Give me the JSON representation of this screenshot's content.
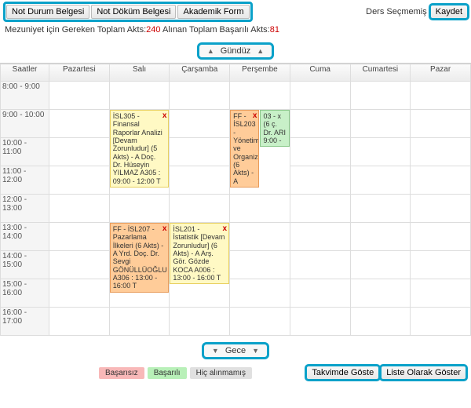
{
  "toolbar": {
    "btn1": "Not Durum Belgesi",
    "btn2": "Not Döküm Belgesi",
    "btn3": "Akademik Form",
    "right_label": "Ders Seçmemiş",
    "save": "Kaydet"
  },
  "status": {
    "prefix": "Mezuniyet için Gereken Toplam Akts:",
    "req": "240",
    "mid": " Alınan Toplam Başarılı Akts:",
    "done": "81"
  },
  "sections": {
    "day": "Gündüz",
    "night": "Gece"
  },
  "headers": {
    "h0": "Saatler",
    "h1": "Pazartesi",
    "h2": "Salı",
    "h3": "Çarşamba",
    "h4": "Perşembe",
    "h5": "Cuma",
    "h6": "Cumartesi",
    "h7": "Pazar"
  },
  "hours": {
    "r0": "8:00 - 9:00",
    "r1": "9:00 - 10:00",
    "r2": "10:00 - 11:00",
    "r3": "11:00 - 12:00",
    "r4": "12:00 - 13:00",
    "r5": "13:00 - 14:00",
    "r6": "14:00 - 15:00",
    "r7": "15:00 - 16:00",
    "r8": "16:00 - 17:00"
  },
  "blocks": {
    "b1": "İSL305 - Finansal Raporlar Analizi [Devam Zorunludur] (5 Akts) - A Doç. Dr. Hüseyin YILMAZ A305 : 09:00 - 12:00 T",
    "b2a": "FF - İSL203 - Yönetim ve Organiz (6 Akts) - A",
    "b2b": "03 - x (6 ç. Dr. ARI 9:00 -",
    "b3": "FF - İSL207 - Pazarlama İlkeleri (6 Akts) - A Yrd. Doç. Dr. Sevgi GÖNÜLLÜOĞLU A306 : 13:00 - 16:00 T",
    "b4": "İSL201 - İstatistik [Devam Zorunludur] (6 Akts) - A Arş. Gör. Gözde KOCA A006 : 13:00 - 16:00 T"
  },
  "x": "x",
  "legend": {
    "fail": "Başarısız",
    "pass": "Başarılı",
    "none": "Hiç alınmamış"
  },
  "bottom": {
    "cal": "Takvimde Göste",
    "list": "Liste Olarak Göster"
  }
}
